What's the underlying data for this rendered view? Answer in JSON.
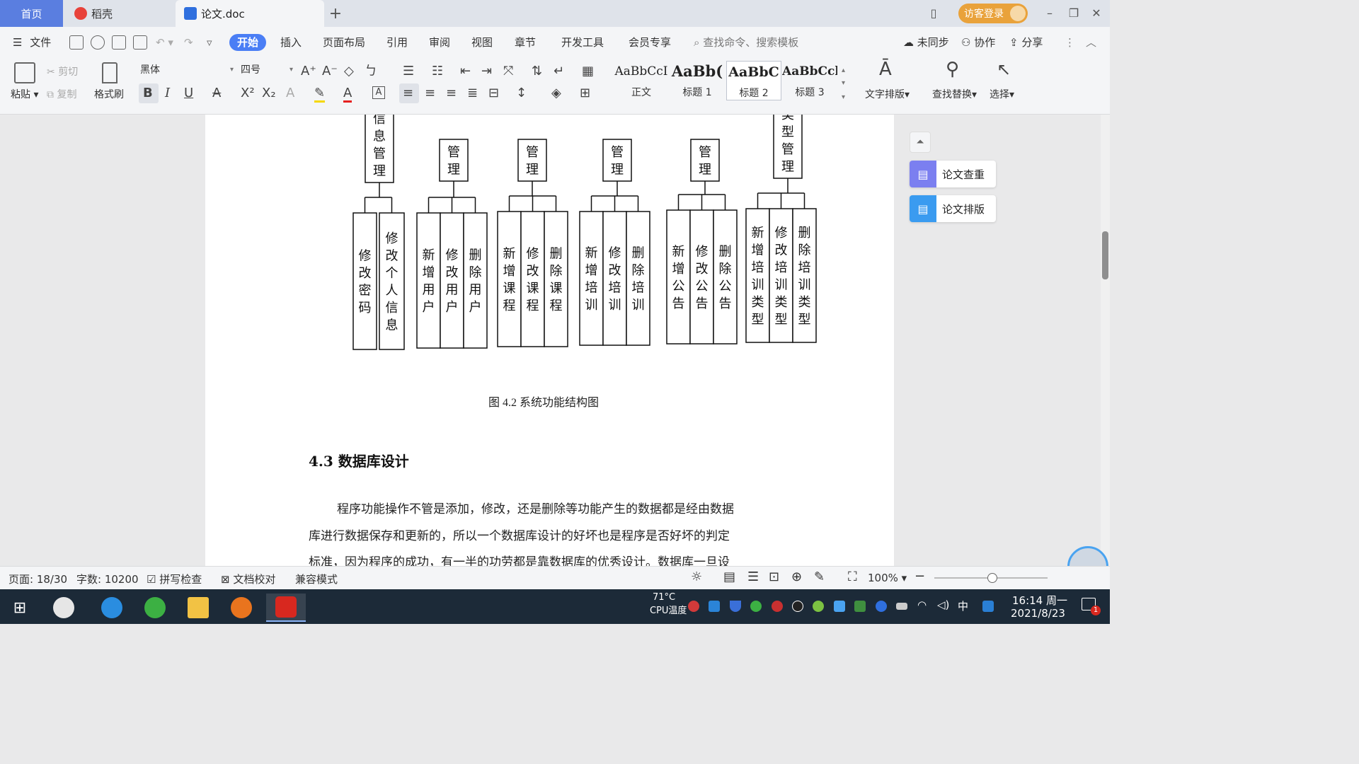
{
  "tabs": {
    "home": "首页",
    "daoke": "稻壳",
    "doc": "论文.doc",
    "add": "+"
  },
  "titlebar": {
    "visitor_login": "访客登录"
  },
  "menu": {
    "file": "文件",
    "items": [
      "开始",
      "插入",
      "页面布局",
      "引用",
      "审阅",
      "视图",
      "章节",
      "开发工具",
      "会员专享"
    ],
    "search": "查找命令、搜索模板",
    "unsynced": "未同步",
    "collab": "协作",
    "share": "分享"
  },
  "ribbon": {
    "paste": "粘贴",
    "cut": "剪切",
    "copy": "复制",
    "format_painter": "格式刷",
    "font_family": "黑体",
    "font_size": "四号",
    "styles": [
      {
        "preview": "AaBbCcI",
        "name": "正文"
      },
      {
        "preview": "AaBb(",
        "name": "标题 1"
      },
      {
        "preview": "AaBbC",
        "name": "标题 2"
      },
      {
        "preview": "AaBbCcl",
        "name": "标题 3"
      }
    ],
    "text_layout": "文字排版",
    "find_replace": "查找替换",
    "select": "选择"
  },
  "diagram": {
    "top_boxes": [
      "信息管理",
      "管理",
      "管理",
      "管理",
      "管理",
      "类型管理"
    ],
    "groups": [
      {
        "children": [
          "修改密码",
          "修改个人信息"
        ]
      },
      {
        "children": [
          "新增用户",
          "修改用户",
          "删除用户"
        ]
      },
      {
        "children": [
          "新增课程",
          "修改课程",
          "删除课程"
        ]
      },
      {
        "children": [
          "新增培训",
          "修改培训",
          "删除培训"
        ]
      },
      {
        "children": [
          "新增公告",
          "修改公告",
          "删除公告"
        ]
      },
      {
        "children": [
          "新增培训类型",
          "修改培训类型",
          "删除培训类型"
        ]
      }
    ]
  },
  "document": {
    "caption": "图 4.2  系统功能结构图",
    "section_heading": "4.3  数据库设计",
    "para_lines": [
      "程序功能操作不管是添加，修改，还是删除等功能产生的数据都是经由数据",
      "库进行数据保存和更新的，所以一个数据库设计的好坏也是程序是否好坏的判定",
      "标准，因为程序的成功，有一半的功劳都是靠数据库的优秀设计。数据库一旦设"
    ]
  },
  "side_panel": {
    "items": [
      "论文查重",
      "论文排版"
    ],
    "colors": [
      "#7b7ff0",
      "#3a9bf0"
    ]
  },
  "statusbar": {
    "page": "页面: 18/30",
    "words": "字数: 10200",
    "spellcheck": "拼写检查",
    "doc_check": "文档校对",
    "compat": "兼容模式",
    "zoom": "100%"
  },
  "taskbar": {
    "cpu_temp": "71°C",
    "cpu_label": "CPU温度",
    "ime": "中",
    "time": "16:14 周一",
    "date": "2021/8/23",
    "notif_count": "1"
  },
  "colors": {
    "accent": "#4a7ef5",
    "home_tab": "#5a7ee0",
    "visitor": "#e9a23b",
    "taskbar": "#1c2a38"
  }
}
